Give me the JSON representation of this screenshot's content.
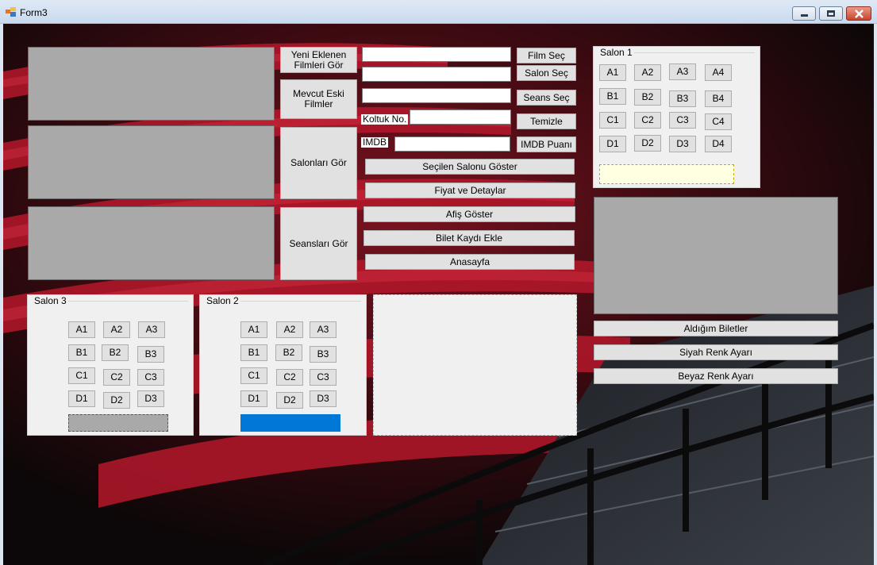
{
  "window": {
    "title": "Form3"
  },
  "nav_buttons": {
    "yeni": "Yeni Eklenen Filmleri Gör",
    "eski": "Mevcut Eski Filmler",
    "salonlar": "Salonları Gör",
    "seanslar": "Seansları Gör"
  },
  "form": {
    "film_sec": "Film Seç",
    "salon_sec": "Salon Seç",
    "seans_sec": "Seans Seç",
    "temizle": "Temizle",
    "imdb_puani": "IMDB Puanı",
    "koltuk_label": "Koltuk No.",
    "imdb_label": "IMDB",
    "film_value": "",
    "salon_value": "",
    "seans_value": "",
    "koltuk_value": "",
    "imdb_value": ""
  },
  "actions": {
    "secilen_salon": "Seçilen Salonu Göster",
    "fiyat": "Fiyat ve Detaylar",
    "afis": "Afiş Göster",
    "bilet_kaydi": "Bilet Kaydı Ekle",
    "anasayfa": "Anasayfa"
  },
  "right_buttons": {
    "biletler": "Aldığım Biletler",
    "siyah": "Siyah Renk Ayarı",
    "beyaz": "Beyaz Renk Ayarı"
  },
  "salon1": {
    "title": "Salon 1",
    "seats": [
      "A1",
      "A2",
      "A3",
      "A4",
      "B1",
      "B2",
      "B3",
      "B4",
      "C1",
      "C2",
      "C3",
      "C4",
      "D1",
      "D2",
      "D3",
      "D4"
    ],
    "indicator_color": "#ffffe1"
  },
  "salon2": {
    "title": "Salon 2",
    "seats": [
      "A1",
      "A2",
      "A3",
      "B1",
      "B2",
      "B3",
      "C1",
      "C2",
      "C3",
      "D1",
      "D2",
      "D3"
    ],
    "indicator_color": "#0078d7"
  },
  "salon3": {
    "title": "Salon 3",
    "seats": [
      "A1",
      "A2",
      "A3",
      "B1",
      "B2",
      "B3",
      "C1",
      "C2",
      "C3",
      "D1",
      "D2",
      "D3"
    ],
    "indicator_color": "#a9a9a9"
  }
}
